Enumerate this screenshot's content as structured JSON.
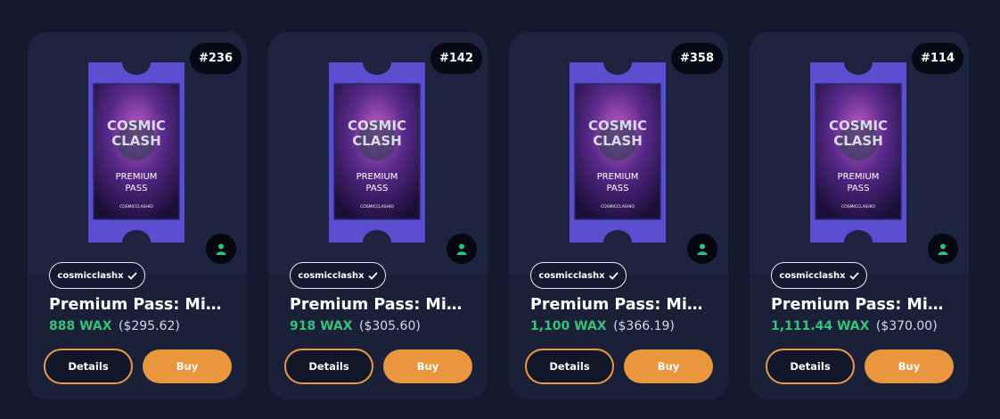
{
  "cards": [
    {
      "edition": "#236",
      "collection": "cosmicclashx",
      "name": "Premium Pass: Mil...",
      "price_wax": "888 WAX",
      "price_usd": "($295.62)",
      "details_label": "Details",
      "buy_label": "Buy",
      "ticket": {
        "line1": "COSMIC",
        "line2": "CLASH",
        "sub1": "PREMIUM",
        "sub2": "PASS",
        "footer": "COSMICCLASHIO"
      }
    },
    {
      "edition": "#142",
      "collection": "cosmicclashx",
      "name": "Premium Pass: Mil...",
      "price_wax": "918 WAX",
      "price_usd": "($305.60)",
      "details_label": "Details",
      "buy_label": "Buy",
      "ticket": {
        "line1": "COSMIC",
        "line2": "CLASH",
        "sub1": "PREMIUM",
        "sub2": "PASS",
        "footer": "COSMICCLASHIO"
      }
    },
    {
      "edition": "#358",
      "collection": "cosmicclashx",
      "name": "Premium Pass: Mil...",
      "price_wax": "1,100 WAX",
      "price_usd": "($366.19)",
      "details_label": "Details",
      "buy_label": "Buy",
      "ticket": {
        "line1": "COSMIC",
        "line2": "CLASH",
        "sub1": "PREMIUM",
        "sub2": "PASS",
        "footer": "COSMICCLASHIO"
      }
    },
    {
      "edition": "#114",
      "collection": "cosmicclashx",
      "name": "Premium Pass: Mil...",
      "price_wax": "1,111.44 WAX",
      "price_usd": "($370.00)",
      "details_label": "Details",
      "buy_label": "Buy",
      "ticket": {
        "line1": "COSMIC",
        "line2": "CLASH",
        "sub1": "PREMIUM",
        "sub2": "PASS",
        "footer": "COSMICCLASHIO"
      }
    }
  ],
  "icons": {
    "verified": "check-icon",
    "owner": "user-icon"
  },
  "colors": {
    "background": "#141a2e",
    "card": "#1d2440",
    "accent": "#ea963e",
    "wax_price": "#36c27a",
    "verified_owner": "#2ec27e"
  }
}
